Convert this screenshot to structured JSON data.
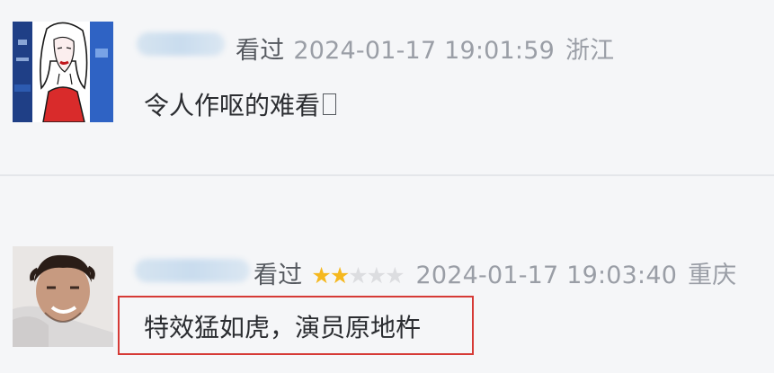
{
  "comments": [
    {
      "watched_label": "看过",
      "datetime": "2024-01-17 19:01:59",
      "location": "浙江",
      "text": "令人作呕的难看",
      "text_trailing_glyph": "□",
      "avatar_icon": "illustrated-woman-avatar"
    },
    {
      "watched_label": "看过",
      "rating": 2,
      "rating_max": 5,
      "datetime": "2024-01-17 19:03:40",
      "location": "重庆",
      "text": "特效猛如虎，演员原地杵",
      "avatar_icon": "man-photo-avatar",
      "highlight_color": "#d63a36"
    }
  ],
  "colors": {
    "star_on": "#f5b81f",
    "star_off": "#dcdde0",
    "meta_text": "#9a9ea6",
    "content_text": "#2b2d31",
    "background": "#f5f6f8"
  }
}
